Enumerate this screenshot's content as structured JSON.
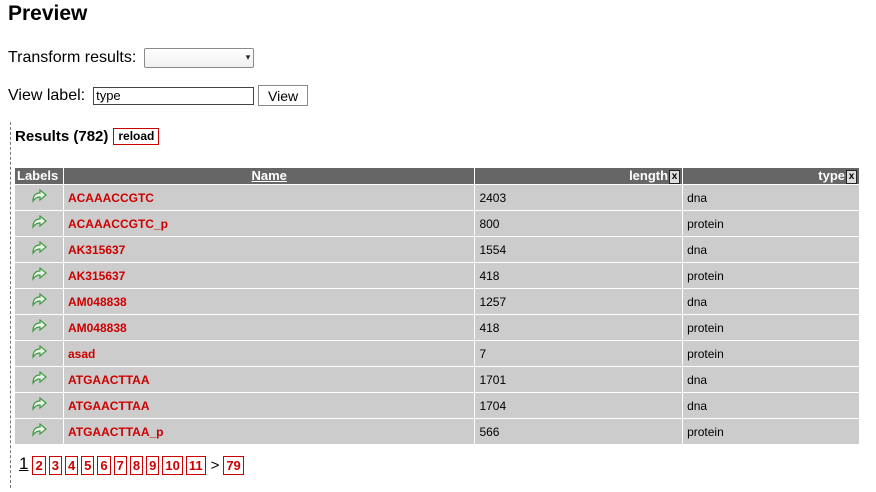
{
  "page_title": "Preview",
  "transform": {
    "label": "Transform results:",
    "selected": ""
  },
  "view": {
    "label": "View label:",
    "value": "type",
    "button": "View"
  },
  "results": {
    "heading": "Results (782)",
    "reload": "reload",
    "columns": {
      "labels": "Labels",
      "name": "Name",
      "length": "length",
      "type": "type",
      "remove": "x"
    },
    "rows": [
      {
        "name": "ACAAACCGTC",
        "length": "2403",
        "type": "dna"
      },
      {
        "name": "ACAAACCGTC_p",
        "length": "800",
        "type": "protein"
      },
      {
        "name": "AK315637",
        "length": "1554",
        "type": "dna"
      },
      {
        "name": "AK315637",
        "length": "418",
        "type": "protein"
      },
      {
        "name": "AM048838",
        "length": "1257",
        "type": "dna"
      },
      {
        "name": "AM048838",
        "length": "418",
        "type": "protein"
      },
      {
        "name": "asad",
        "length": "7",
        "type": "protein"
      },
      {
        "name": "ATGAACTTAA",
        "length": "1701",
        "type": "dna"
      },
      {
        "name": "ATGAACTTAA",
        "length": "1704",
        "type": "dna"
      },
      {
        "name": "ATGAACTTAA_p",
        "length": "566",
        "type": "protein"
      }
    ],
    "row_icon": "green-arrow-icon"
  },
  "pager": {
    "current": "1",
    "pages": [
      "2",
      "3",
      "4",
      "5",
      "6",
      "7",
      "8",
      "9",
      "10",
      "11"
    ],
    "next": ">",
    "last": "79"
  },
  "colors": {
    "link": "#cc0000",
    "header": "#666666",
    "cell": "#cccccc",
    "icon": "#3f9b3f"
  }
}
